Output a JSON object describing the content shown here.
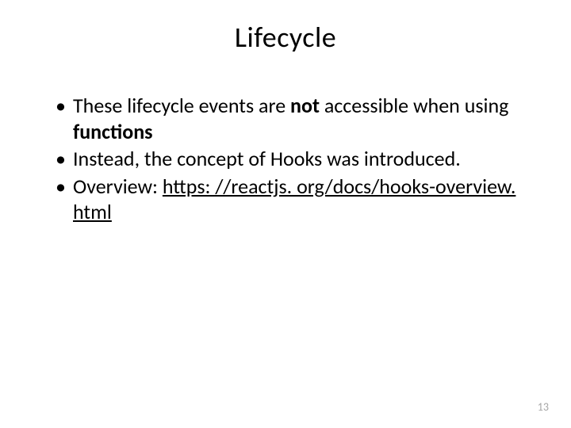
{
  "slide": {
    "title": "Lifecycle",
    "bullets": [
      {
        "prefix": "These lifecycle events are ",
        "bold1": "not",
        "mid": " accessible when using ",
        "bold2": "functions",
        "suffix": ""
      },
      {
        "text": "Instead, the concept of Hooks was introduced."
      },
      {
        "prefix": "Overview: ",
        "link": "https: //reactjs. org/docs/hooks-overview. html"
      }
    ],
    "page_number": "13"
  }
}
